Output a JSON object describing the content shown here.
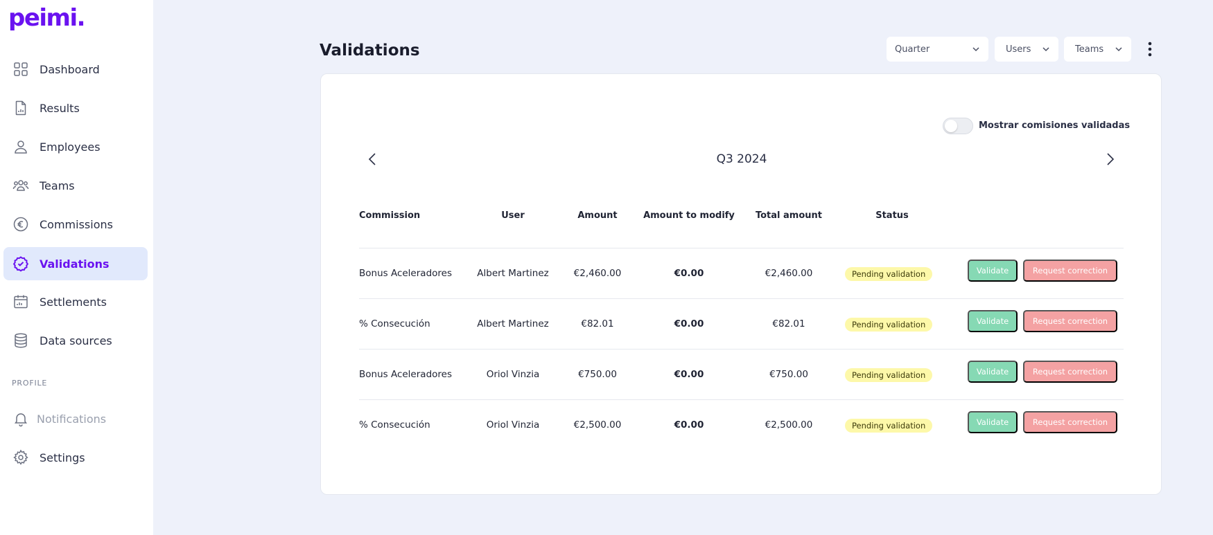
{
  "app": {
    "logo": "peimi."
  },
  "sidebar": {
    "items": [
      {
        "label": "Dashboard",
        "icon": "grid-icon"
      },
      {
        "label": "Results",
        "icon": "document-chart-icon"
      },
      {
        "label": "Employees",
        "icon": "user-icon"
      },
      {
        "label": "Teams",
        "icon": "users-icon"
      },
      {
        "label": "Commissions",
        "icon": "euro-icon"
      },
      {
        "label": "Validations",
        "icon": "check-circle-icon",
        "active": true
      },
      {
        "label": "Settlements",
        "icon": "calendar-icon"
      },
      {
        "label": "Data sources",
        "icon": "database-icon"
      }
    ],
    "profile_section": "PROFILE",
    "profile_items": [
      {
        "label": "Notifications",
        "icon": "bell-icon",
        "disabled": true
      },
      {
        "label": "Settings",
        "icon": "gear-icon"
      }
    ]
  },
  "header": {
    "title": "Validations",
    "filters": {
      "quarter": "Quarter",
      "users": "Users",
      "teams": "Teams"
    }
  },
  "card": {
    "toggle_label": "Mostrar comisiones validadas",
    "toggle_on": false,
    "period": "Q3 2024",
    "columns": [
      "Commission",
      "User",
      "Amount",
      "Amount to modify",
      "Total amount",
      "Status"
    ],
    "rows": [
      {
        "commission": "Bonus Aceleradores",
        "user": "Albert Martinez",
        "amount": "€2,460.00",
        "modify": "€0.00",
        "total": "€2,460.00",
        "status": "Pending validation"
      },
      {
        "commission": "% Consecución",
        "user": "Albert Martinez",
        "amount": "€82.01",
        "modify": "€0.00",
        "total": "€82.01",
        "status": "Pending validation"
      },
      {
        "commission": "Bonus Aceleradores",
        "user": "Oriol Vinzia",
        "amount": "€750.00",
        "modify": "€0.00",
        "total": "€750.00",
        "status": "Pending validation"
      },
      {
        "commission": "% Consecución",
        "user": "Oriol Vinzia",
        "amount": "€2,500.00",
        "modify": "€0.00",
        "total": "€2,500.00",
        "status": "Pending validation"
      }
    ],
    "validate_label": "Validate",
    "request_label": "Request correction"
  },
  "colors": {
    "brand": "#6a12f0",
    "active_bg": "#e1e9fc",
    "validate": "#86d9b4",
    "request": "#f4a2a3",
    "badge": "#fdf8a9"
  }
}
